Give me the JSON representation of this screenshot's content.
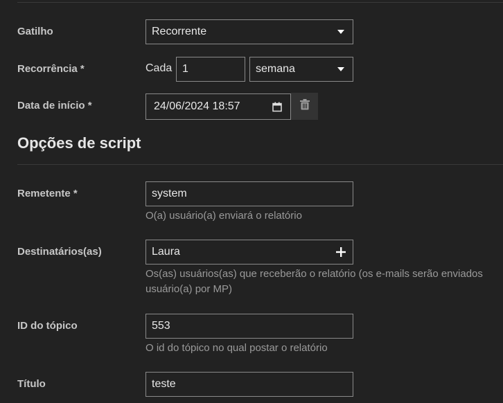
{
  "trigger": {
    "label": "Gatilho",
    "value": "Recorrente"
  },
  "recurrence": {
    "label": "Recorrência *",
    "every_label": "Cada",
    "amount": "1",
    "unit": "semana"
  },
  "start_date": {
    "label": "Data de início *",
    "value": "24/06/2024 18:57"
  },
  "script_section": {
    "title": "Opções de script"
  },
  "sender": {
    "label": "Remetente *",
    "value": "system",
    "help": "O(a) usuário(a) enviará o relatório"
  },
  "recipients": {
    "label": "Destinatários(as)",
    "value": "Laura",
    "help_line1": "Os(as) usuários(as) que receberão o relatório (os e-mails serão enviados",
    "help_line2": "usuário(a) por MP)"
  },
  "topic_id": {
    "label": "ID do tópico",
    "value": "553",
    "help": "O id do tópico no qual postar o relatório"
  },
  "title_field": {
    "label": "Título",
    "value": "teste"
  },
  "icons": {
    "calendar": "calendar-icon",
    "trash": "trash-icon",
    "plus": "plus-icon",
    "caret": "chevron-down-icon"
  }
}
